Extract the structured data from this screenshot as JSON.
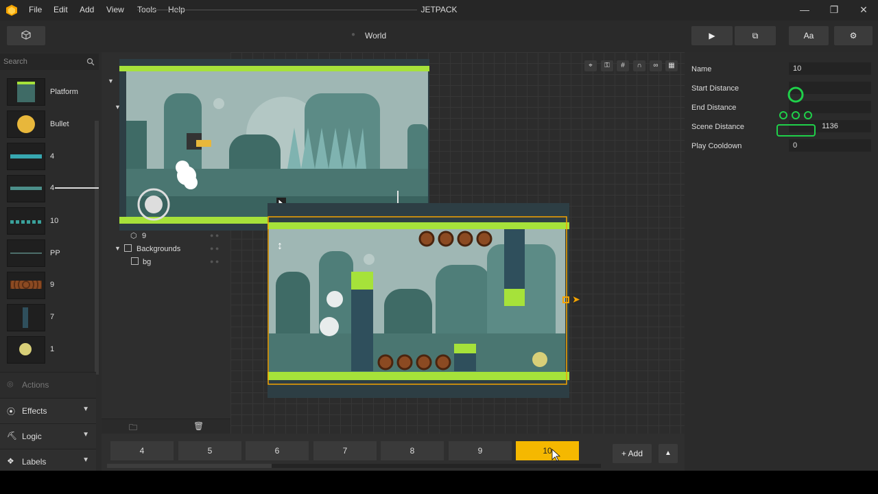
{
  "app": {
    "title": "JETPACK"
  },
  "menu": [
    "File",
    "Edit",
    "Add",
    "View",
    "Tools",
    "Help"
  ],
  "toolbar": {
    "world_label": "World",
    "font_button": "Aa"
  },
  "left": {
    "search_placeholder": "Search",
    "assets": [
      {
        "label": "Platform"
      },
      {
        "label": "Bullet"
      },
      {
        "label": "4"
      },
      {
        "label": "4"
      },
      {
        "label": "10"
      },
      {
        "label": "PP"
      },
      {
        "label": "9"
      },
      {
        "label": "7"
      },
      {
        "label": "1"
      }
    ],
    "sections": [
      {
        "label": "Actions"
      },
      {
        "label": "Effects"
      },
      {
        "label": "Logic"
      },
      {
        "label": "Labels"
      }
    ]
  },
  "tree": {
    "items": [
      {
        "label": "9"
      },
      {
        "label": "Backgrounds"
      },
      {
        "label": "bg"
      }
    ]
  },
  "properties": {
    "name": {
      "label": "Name",
      "value": "10"
    },
    "start_distance": {
      "label": "Start Distance",
      "value": ""
    },
    "end_distance": {
      "label": "End Distance",
      "value": ""
    },
    "scene_distance": {
      "label": "Scene Distance",
      "value": "1136"
    },
    "play_cooldown": {
      "label": "Play Cooldown",
      "value": "0"
    }
  },
  "scenes": {
    "tabs": [
      "4",
      "5",
      "6",
      "7",
      "8",
      "9",
      "10"
    ],
    "active": "10",
    "add_label": "Add"
  },
  "colors": {
    "accent": "#f5b800",
    "slime": "#a6e23a",
    "sky": "#9fb7b4",
    "hill": "#3f6b66"
  }
}
